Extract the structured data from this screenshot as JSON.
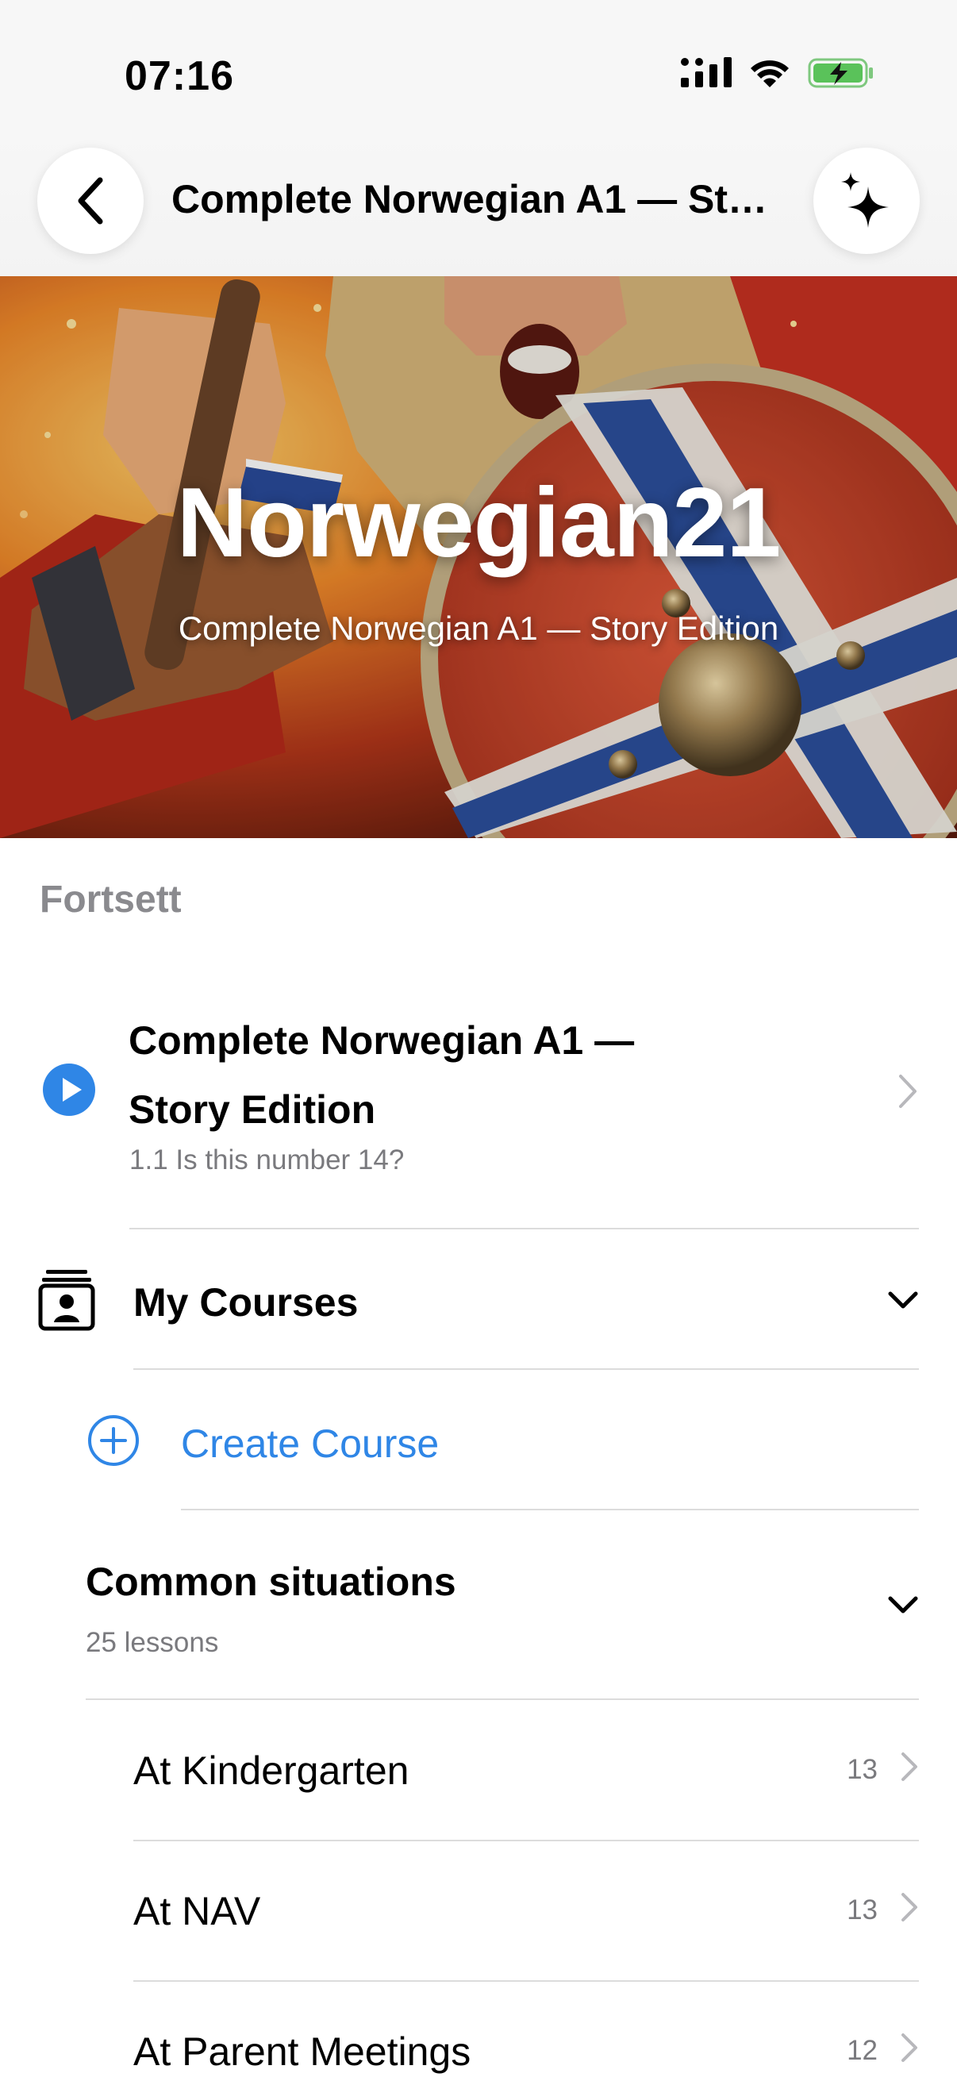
{
  "status_bar": {
    "time": "07:16",
    "icons": [
      "cellular-signal-icon",
      "wifi-icon",
      "battery-charging-icon"
    ]
  },
  "nav": {
    "title": "Complete Norwegian A1 — Story Edition",
    "back_icon": "chevron-left-icon",
    "ai_icon": "sparkles-icon"
  },
  "hero": {
    "title": "Norwegian21",
    "subtitle": "Complete Norwegian A1 — Story Edition"
  },
  "continue_section": {
    "header": "Fortsett",
    "course_title_line1": "Complete Norwegian A1 —",
    "course_title_line2": "Story Edition",
    "lesson": "1.1 Is this number 14?"
  },
  "my_courses": {
    "label": "My Courses"
  },
  "create_course": {
    "label": "Create Course"
  },
  "group": {
    "title": "Common situations",
    "subtitle": "25 lessons",
    "lessons": [
      {
        "label": "At Kindergarten",
        "count": "13"
      },
      {
        "label": "At NAV",
        "count": "13"
      },
      {
        "label": "At Parent Meetings",
        "count": "12"
      }
    ]
  },
  "colors": {
    "accent": "#2f86e6",
    "secondary_text": "#7a7a7e",
    "section_header": "#8a8a8e",
    "divider": "#dcdcdc"
  }
}
